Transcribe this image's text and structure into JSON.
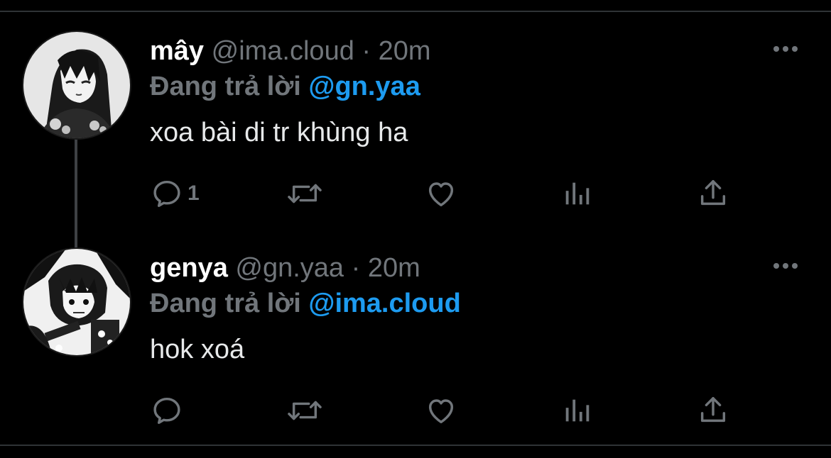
{
  "tweets": [
    {
      "display_name": "mây",
      "handle": "@ima.cloud",
      "separator": "·",
      "time": "20m",
      "reply_prefix": "Đang trả lời",
      "reply_target": "@gn.yaa",
      "text": "xoa bài di tr khùng ha",
      "reply_count": "1",
      "avatar_icon": "anime-avatar-icon"
    },
    {
      "display_name": "genya",
      "handle": "@gn.yaa",
      "separator": "·",
      "time": "20m",
      "reply_prefix": "Đang trả lời",
      "reply_target": "@ima.cloud",
      "text": "hok xoá",
      "reply_count": "",
      "avatar_icon": "anime-avatar-icon"
    }
  ],
  "icons": {
    "reply": "reply-icon",
    "retweet": "retweet-icon",
    "like": "heart-icon",
    "views": "views-icon",
    "share": "share-icon",
    "more": "more-icon"
  },
  "colors": {
    "background": "#000000",
    "muted": "#71767b",
    "accent": "#1d9bf0",
    "text": "#e7e9ea",
    "divider": "#2f3336"
  }
}
